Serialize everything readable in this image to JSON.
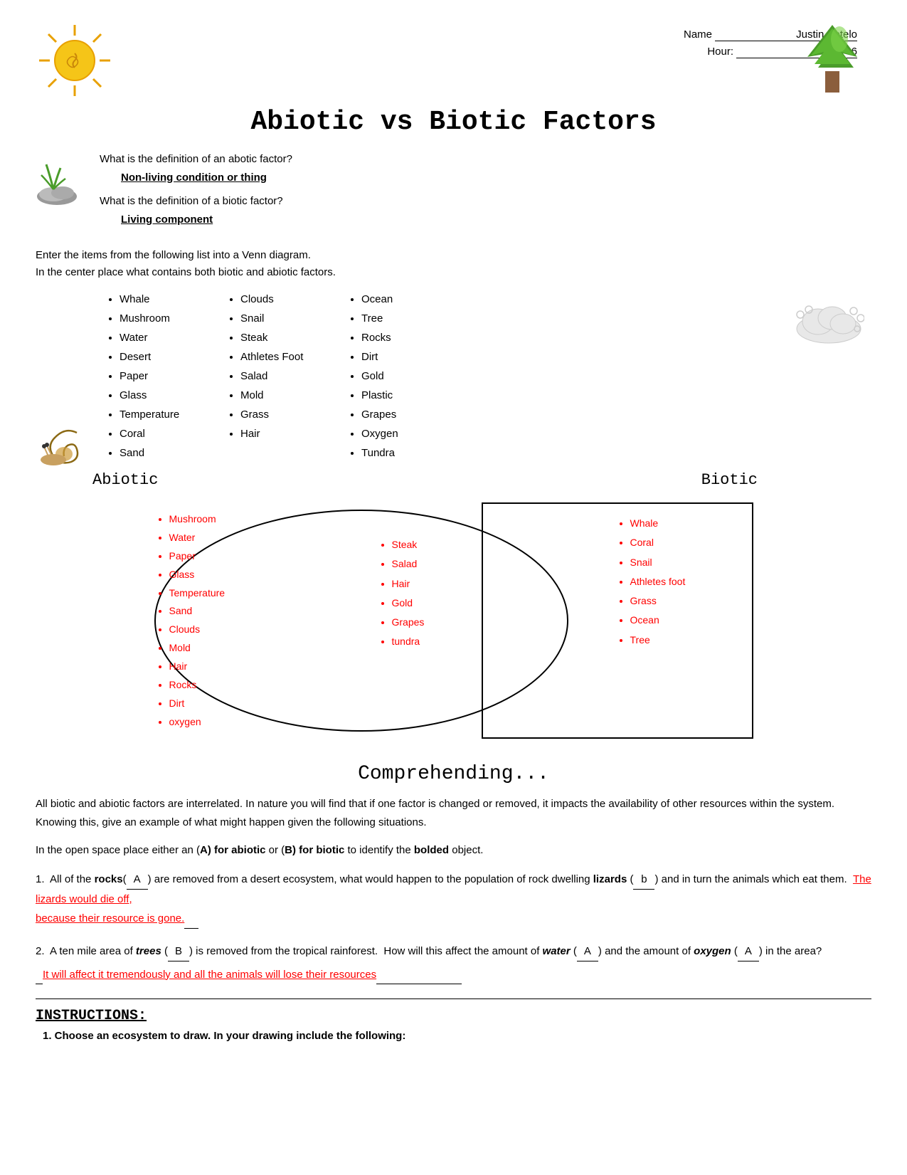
{
  "header": {
    "name_label": "Name",
    "name_value": "Justin Sotelo",
    "hour_label": "Hour:",
    "hour_value": "6"
  },
  "title": "Abiotic vs Biotic Factors",
  "definitions": {
    "abiotic_question": "What is the definition of an abotic factor?",
    "abiotic_answer": "Non-living condition or thing",
    "biotic_question": "What is the definition of a biotic factor?",
    "biotic_answer": "Living component"
  },
  "venn_instruction": "Enter the items from the following list into a Venn diagram.",
  "venn_instruction2": "In the center place what contains both biotic and abiotic factors.",
  "items_col1": [
    "Whale",
    "Mushroom",
    "Water",
    "Desert",
    "Paper",
    "Glass",
    "Temperature",
    "Coral",
    "Sand"
  ],
  "items_col2": [
    "Clouds",
    "Snail",
    "Steak",
    "Athletes Foot",
    "Salad",
    "Mold",
    "Grass",
    "Hair"
  ],
  "items_col3": [
    "Ocean",
    "Tree",
    "Rocks",
    "Dirt",
    "Gold",
    "Plastic",
    "Grapes",
    "Oxygen",
    "Tundra"
  ],
  "venn": {
    "label_abiotic": "Abiotic",
    "label_biotic": "Biotic",
    "left_items": [
      "Mushroom",
      "Water",
      "Paper",
      "Glass",
      "Temperature",
      "Sand",
      "Clouds",
      "Mold",
      "Hair",
      "Rocks",
      "Dirt",
      "oxygen"
    ],
    "center_items": [
      "Steak",
      "Salad",
      "Hair",
      "Gold",
      "Grapes",
      "tundra"
    ],
    "right_items": [
      "Whale",
      "Coral",
      "Snail",
      "Athletes foot",
      "Grass",
      "Ocean",
      "Tree"
    ]
  },
  "comprehending": {
    "title": "Comprehending...",
    "paragraph": "All biotic and abiotic factors are interrelated.  In nature you will find that if one factor is changed or removed, it impacts the availability of other resources within the system.  Knowing this, give an example of what might happen given the following situations.",
    "instruction": "In the open space place either an (A) for abiotic or (B) for biotic to identify the bolded object.",
    "q1_text1": "1.  All of the ",
    "q1_bold1": "rocks",
    "q1_blank1": "A",
    "q1_text2": " are removed from a desert ecosystem, what would happen to the population of rock dwelling ",
    "q1_bold2": "lizards",
    "q1_blank2": " b ",
    "q1_text3": " and in turn the animals which eat them. ",
    "q1_answer": "The lizards would die off, because their resource is gone.",
    "q2_text1": "2.  A ten mile area of ",
    "q2_bold1": "trees",
    "q2_blank1": " B ",
    "q2_text2": " is removed from the tropical rainforest.  How will this affect the amount of ",
    "q2_bold2": "water",
    "q2_blank2": " A ",
    "q2_text3": " and the amount of ",
    "q2_bold3": "oxygen",
    "q2_blank3": " A ",
    "q2_text4": " in the area?",
    "q2_answer": "It will affect it tremendously and all the animals will lose their resources"
  },
  "instructions_section": {
    "title": "INSTRUCTIONS:",
    "item1": "1.  Choose an ecosystem to draw.  In your drawing include the following:"
  }
}
